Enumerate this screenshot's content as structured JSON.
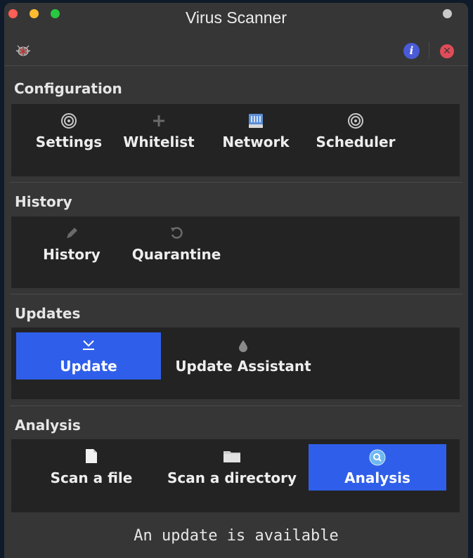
{
  "window": {
    "title": "Virus Scanner"
  },
  "toolbar": {
    "app_icon": "bug-icon",
    "info_icon": "info-icon",
    "info_glyph": "i",
    "close_icon": "close-icon",
    "close_glyph": "✕"
  },
  "sections": {
    "configuration": {
      "title": "Configuration",
      "buttons": [
        {
          "label": "Settings",
          "icon": "gear-icon"
        },
        {
          "label": "Whitelist",
          "icon": "plus-icon"
        },
        {
          "label": "Network",
          "icon": "network-icon"
        },
        {
          "label": "Scheduler",
          "icon": "gear-icon"
        }
      ]
    },
    "history": {
      "title": "History",
      "buttons": [
        {
          "label": "History",
          "icon": "pencil-icon"
        },
        {
          "label": "Quarantine",
          "icon": "undo-icon"
        }
      ]
    },
    "updates": {
      "title": "Updates",
      "buttons": [
        {
          "label": "Update",
          "icon": "download-icon",
          "active": true
        },
        {
          "label": "Update Assistant",
          "icon": "drop-icon"
        }
      ]
    },
    "analysis": {
      "title": "Analysis",
      "buttons": [
        {
          "label": "Scan a file",
          "icon": "file-icon"
        },
        {
          "label": "Scan a directory",
          "icon": "folder-icon"
        },
        {
          "label": "Analysis",
          "icon": "search-icon",
          "active": true
        }
      ]
    }
  },
  "status": {
    "message": "An update is available"
  },
  "colors": {
    "accent": "#2f5fea",
    "window_bg": "#363636",
    "panel_bg": "#232323"
  }
}
